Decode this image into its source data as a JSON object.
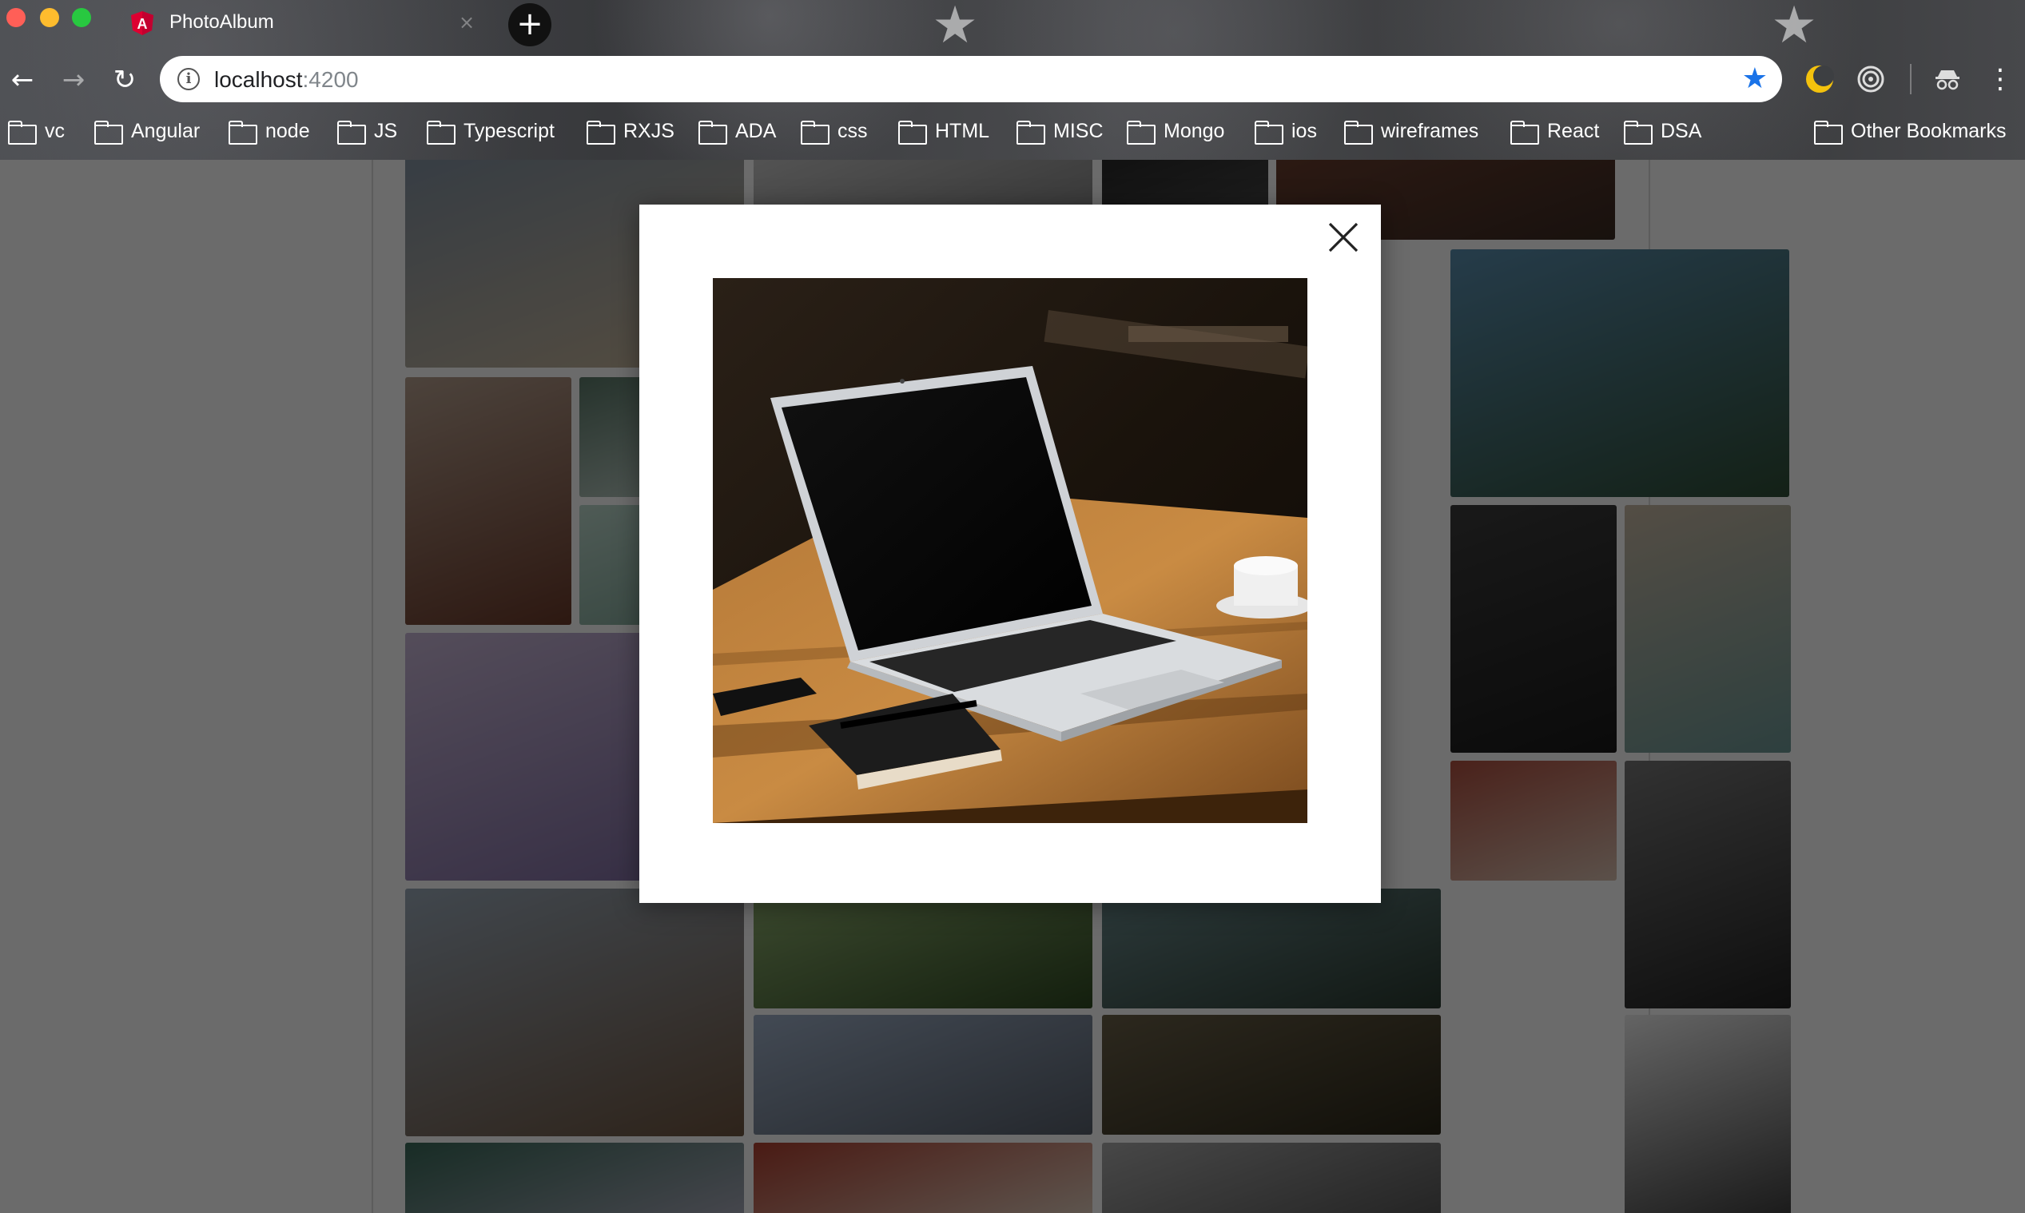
{
  "browser": {
    "tab": {
      "title": "PhotoAlbum",
      "close_glyph": "×"
    },
    "new_tab_glyph": "+",
    "nav": {
      "back_glyph": "←",
      "forward_glyph": "→",
      "reload_glyph": "↻"
    },
    "omnibox": {
      "host": "localhost",
      "port": ":4200",
      "info_glyph": "i",
      "bookmark_star_glyph": "★"
    },
    "bookmarks": [
      "vc",
      "Angular",
      "node",
      "JS",
      "Typescript",
      "RXJS",
      "ADA",
      "css",
      "HTML",
      "MISC",
      "Mongo",
      "ios",
      "wireframes",
      "React",
      "DSA"
    ],
    "other_bookmarks": "Other Bookmarks",
    "menu_glyph": "⋮"
  },
  "modal": {
    "image_subject": "laptop-on-wooden-table",
    "close_icon": "close-icon"
  },
  "colors": {
    "traffic_red": "#ff5f57",
    "traffic_yellow": "#febc2e",
    "traffic_green": "#28c840",
    "star_blue": "#1a73e8",
    "angular_red": "#dd0031",
    "overlay": "rgba(0,0,0,0.58)"
  }
}
